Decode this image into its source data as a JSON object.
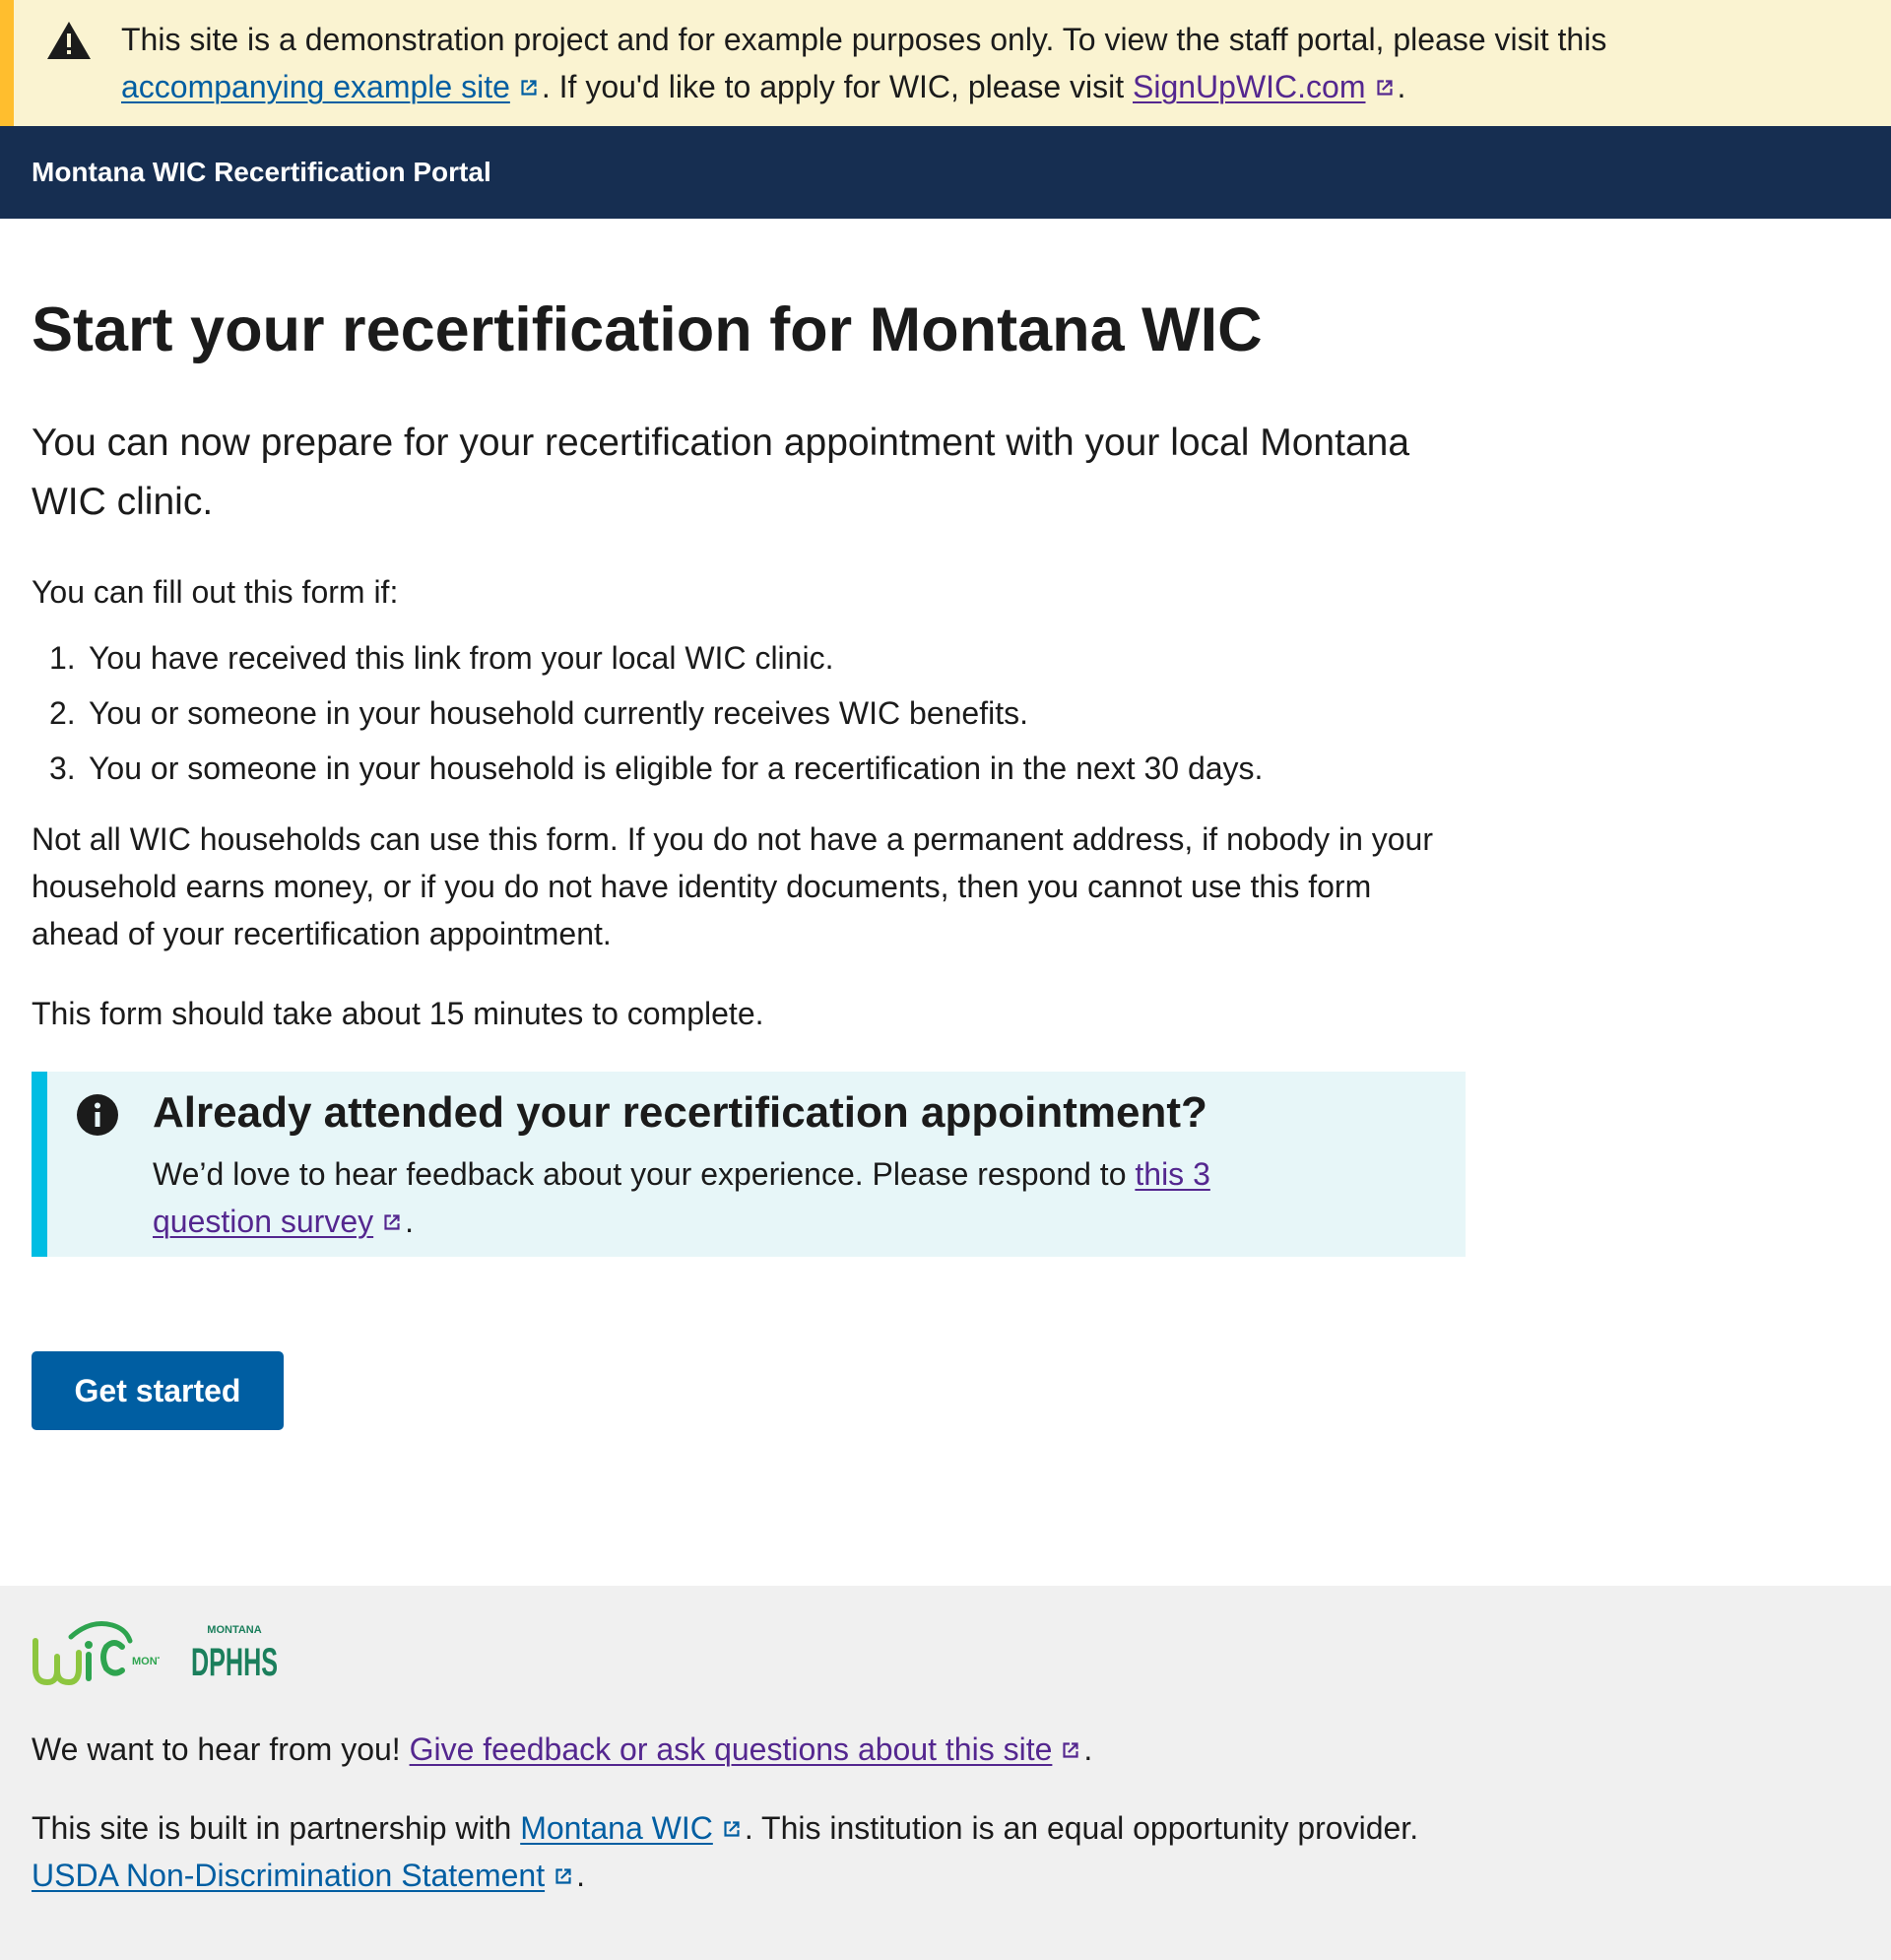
{
  "demo_banner": {
    "text_1": "This site is a demonstration project and for example purposes only. To view the staff portal, please visit this ",
    "example_site_link": "accompanying example site",
    "text_2": ". If you'd like to apply for WIC, please visit ",
    "signup_link": "SignUpWIC.com",
    "text_3": ".",
    "icon": "warning-icon",
    "accent_color": "#ffbe2e",
    "background_color": "#faf3d1"
  },
  "header": {
    "title": "Montana WIC Recertification Portal",
    "background_color": "#162e51"
  },
  "main": {
    "title": "Start your recertification for Montana WIC",
    "lead": "You can now prepare for your recertification appointment with your local Montana WIC clinic.",
    "intro": "You can fill out this form if:",
    "conditions": [
      {
        "num": "1.",
        "text": "You have received this link from your local WIC clinic."
      },
      {
        "num": "2.",
        "text": "You or someone in your household currently receives WIC benefits."
      },
      {
        "num": "3.",
        "text": "You or someone in your household is eligible for a recertification in the next 30 days."
      }
    ],
    "restriction": "Not all WIC households can use this form. If you do not have a permanent address, if nobody in your household earns money, or if you do not have identity documents, then you cannot use this form ahead of your recertification appointment.",
    "duration": "This form should take about 15 minutes to complete.",
    "alert": {
      "heading": "Already attended your recertification appointment?",
      "body_text": "We’d love to hear feedback about your experience. Please respond to ",
      "survey_link": "this 3 question survey",
      "body_end": ".",
      "icon": "info-icon",
      "accent_color": "#00bde3",
      "background_color": "#e7f6f8"
    },
    "get_started_label": "Get started",
    "button_color": "#005ea2"
  },
  "footer": {
    "feedback_text": "We want to hear from you! ",
    "feedback_link": "Give feedback or ask questions about this site",
    "feedback_end": ".",
    "partnership_text": "This site is built in partnership with ",
    "montana_wic_link": "Montana WIC",
    "partnership_text_2": ". This institution is an equal opportunity provider.",
    "usda_link": "USDA Non-Discrimination Statement",
    "usda_end": ".",
    "logo_wic": {
      "brand": "WIC",
      "sub": "MONTANA"
    },
    "logo_dphhs": {
      "top": "MONTANA",
      "brand": "DPHHS"
    },
    "background_color": "#f0f0f0"
  },
  "link_colors": {
    "unvisited": "#005ea2",
    "visited": "#54278f"
  }
}
